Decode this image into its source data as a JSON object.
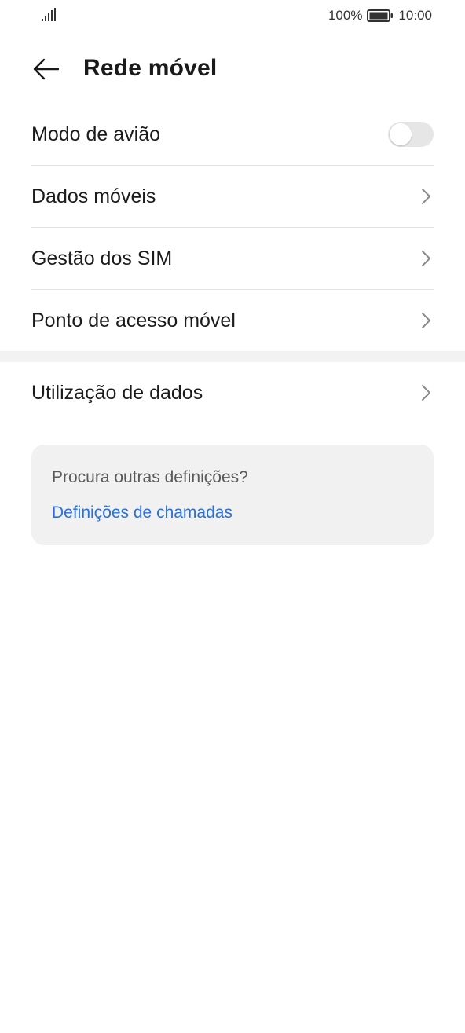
{
  "status_bar": {
    "battery_percent": "100%",
    "time": "10:00",
    "signal_icon": "signal-bars-icon",
    "battery_icon": "battery-full-icon"
  },
  "header": {
    "title": "Rede móvel",
    "back_icon": "arrow-left-icon"
  },
  "settings": {
    "airplane_mode": {
      "label": "Modo de avião",
      "enabled": false
    },
    "items": [
      {
        "label": "Dados móveis"
      },
      {
        "label": "Gestão dos SIM"
      },
      {
        "label": "Ponto de acesso móvel"
      }
    ],
    "data_usage": {
      "label": "Utilização de dados"
    }
  },
  "suggestion_card": {
    "hint": "Procura outras definições?",
    "link": "Definições de chamadas"
  },
  "colors": {
    "accent": "#2a6fdb",
    "toggle_off": "#e6e6e6",
    "card_bg": "#f1f1f1"
  }
}
